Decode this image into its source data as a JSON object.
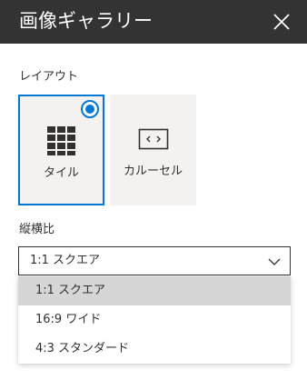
{
  "header": {
    "title": "画像ギャラリー",
    "close_icon": "close-icon"
  },
  "layout_section": {
    "label": "レイアウト",
    "options": [
      {
        "label": "タイル",
        "icon": "grid-tiles-icon",
        "selected": true
      },
      {
        "label": "カルーセル",
        "icon": "carousel-icon",
        "selected": false
      }
    ]
  },
  "aspect_section": {
    "label": "縦横比",
    "selected_value": "1:1 スクエア",
    "chevron_icon": "chevron-down-icon",
    "options": [
      {
        "label": "1:1 スクエア",
        "selected": true
      },
      {
        "label": "16:9 ワイド",
        "selected": false
      },
      {
        "label": "4:3 スタンダード",
        "selected": false
      }
    ]
  },
  "colors": {
    "header_bg": "#333333",
    "accent": "#0078d4",
    "tile_bg": "#f3f2f1",
    "menu_selected_bg": "#d6d6d6"
  }
}
